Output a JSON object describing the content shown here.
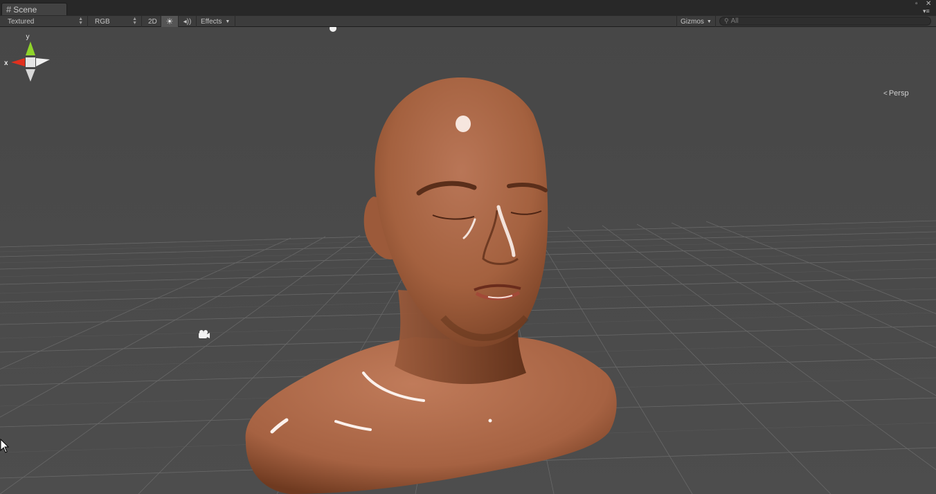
{
  "window": {
    "tab_icon": "grid-icon",
    "tab_label": "Scene",
    "maximize_glyph": "▫",
    "close_glyph": "✕",
    "menu_glyph": "▾≡"
  },
  "toolbar": {
    "draw_mode": "Textured",
    "render_mode": "RGB",
    "two_d_label": "2D",
    "lighting_icon": "sun-icon",
    "audio_icon": "speaker-icon",
    "effects_label": "Effects",
    "gizmos_label": "Gizmos",
    "search_placeholder": "All",
    "search_icon": "magnifier-icon"
  },
  "gizmo": {
    "y_label": "y",
    "x_label": "x",
    "projection_label": "Persp",
    "colors": {
      "x": "#e0301e",
      "y": "#8fd42a",
      "z": "#ffffff"
    }
  },
  "scene": {
    "model": "bust-of-bald-man",
    "camera_icon": "camera-icon",
    "directional_light_icon": "light-icon",
    "background": "#4a4a4a",
    "grid_color": "#6e6e6e"
  }
}
